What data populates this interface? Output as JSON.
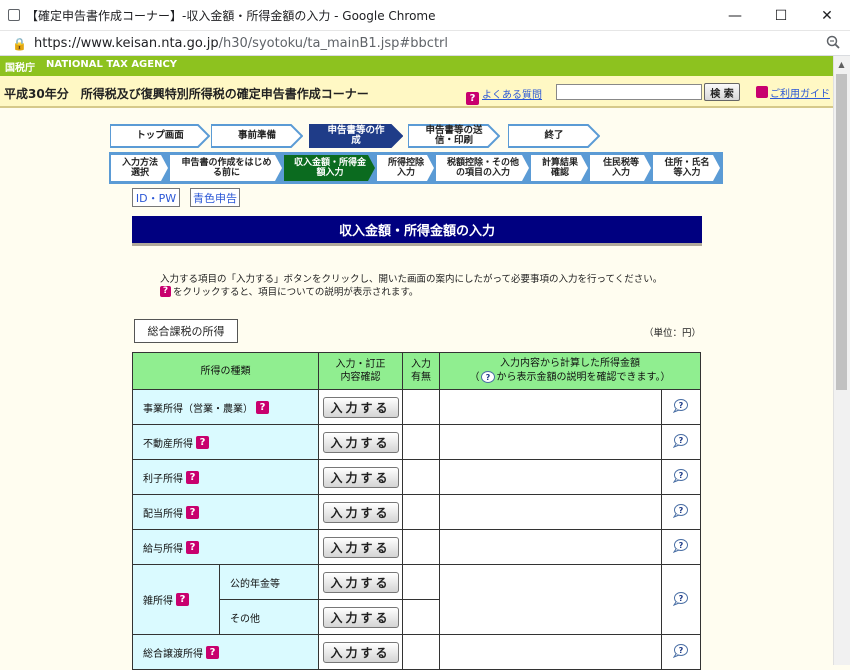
{
  "browser": {
    "title": "【確定申告書作成コーナー】-収入金額・所得金額の入力 - Google Chrome",
    "url_host": "https://www.keisan.nta.go.jp",
    "url_path": "/h30/syotoku/ta_mainB1.jsp#bbctrl",
    "minimize": "—",
    "maximize": "☐",
    "close": "✕"
  },
  "site": {
    "agency_logo": "国税庁",
    "agency_name": "NATIONAL TAX AGENCY",
    "corner_title": "平成30年分　所得税及び復興特別所得税の確定申告書作成コーナー",
    "faq": "よくある質問",
    "search_button": "検 索",
    "guide": "ご利用ガイド"
  },
  "steps": {
    "main": [
      "トップ画面",
      "事前準備",
      "申告書等の作成",
      "申告書等の送信・印刷",
      "終了"
    ],
    "active_main": 2,
    "sub": [
      "入力方法選択",
      "申告書の作成をはじめる前に",
      "収入金額・所得金額入力",
      "所得控除入力",
      "税額控除・その他の項目の入力",
      "計算結果確認",
      "住民税等入力",
      "住所・氏名等入力"
    ],
    "active_sub": 2
  },
  "links": {
    "idpw": "ID・PW",
    "aoiro": "青色申告"
  },
  "page": {
    "heading": "収入金額・所得金額の入力",
    "description_line1": "入力する項目の「入力する」ボタンをクリックし、開いた画面の案内にしたがって必要事項の入力を行ってください。",
    "description_line2": "をクリックすると、項目についての説明が表示されます。",
    "section": "総合課税の所得",
    "unit": "（単位：円）"
  },
  "table": {
    "headers": {
      "kind": "所得の種類",
      "confirm": "入力・訂正\n内容確認",
      "status": "入力\n有無",
      "amount_line1": "入力内容から計算した所得金額",
      "amount_line2_pre": "（",
      "amount_line2_post": "から表示金額の説明を確認できます。）"
    },
    "rows": [
      {
        "kind": "事業所得（営業・農業）",
        "button": "入力する"
      },
      {
        "kind": "不動産所得",
        "button": "入力する"
      },
      {
        "kind": "利子所得",
        "button": "入力する"
      },
      {
        "kind": "配当所得",
        "button": "入力する"
      },
      {
        "kind": "給与所得",
        "button": "入力する"
      }
    ],
    "misc": {
      "kind": "雑所得",
      "sub": [
        {
          "label": "公的年金等",
          "button": "入力する"
        },
        {
          "label": "その他",
          "button": "入力する"
        }
      ]
    },
    "last": {
      "kind": "総合譲渡所得",
      "button": "入力する"
    }
  },
  "colors": {
    "nta_green": "#8dc21f",
    "heading_navy": "#000080",
    "header_green": "#90ee90",
    "kind_cyan": "#dafaff",
    "help_magenta": "#c8006e"
  }
}
